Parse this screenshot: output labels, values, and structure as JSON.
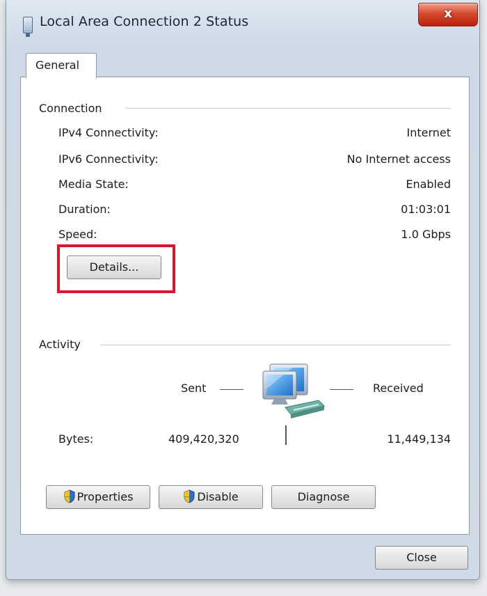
{
  "window": {
    "title": "Local Area Connection 2 Status",
    "close_glyph": "x"
  },
  "tabs": [
    {
      "label": "General",
      "active": true
    }
  ],
  "connection": {
    "group_label": "Connection",
    "rows": [
      {
        "label": "IPv4 Connectivity:",
        "value": "Internet"
      },
      {
        "label": "IPv6 Connectivity:",
        "value": "No Internet access"
      },
      {
        "label": "Media State:",
        "value": "Enabled"
      },
      {
        "label": "Duration:",
        "value": "01:03:01"
      },
      {
        "label": "Speed:",
        "value": "1.0 Gbps"
      }
    ],
    "details_button": "Details..."
  },
  "activity": {
    "group_label": "Activity",
    "sent_label": "Sent",
    "received_label": "Received",
    "bytes_label": "Bytes:",
    "bytes_sent": "409,420,320",
    "bytes_received": "11,449,134"
  },
  "buttons": {
    "properties": "Properties",
    "disable": "Disable",
    "diagnose": "Diagnose",
    "close": "Close"
  },
  "icons": {
    "title": "network-connection-icon",
    "activity": "network-computer-icon",
    "shield": "uac-shield-icon"
  },
  "colors": {
    "highlight": "#d9162a",
    "close_button": "#c8391c"
  }
}
